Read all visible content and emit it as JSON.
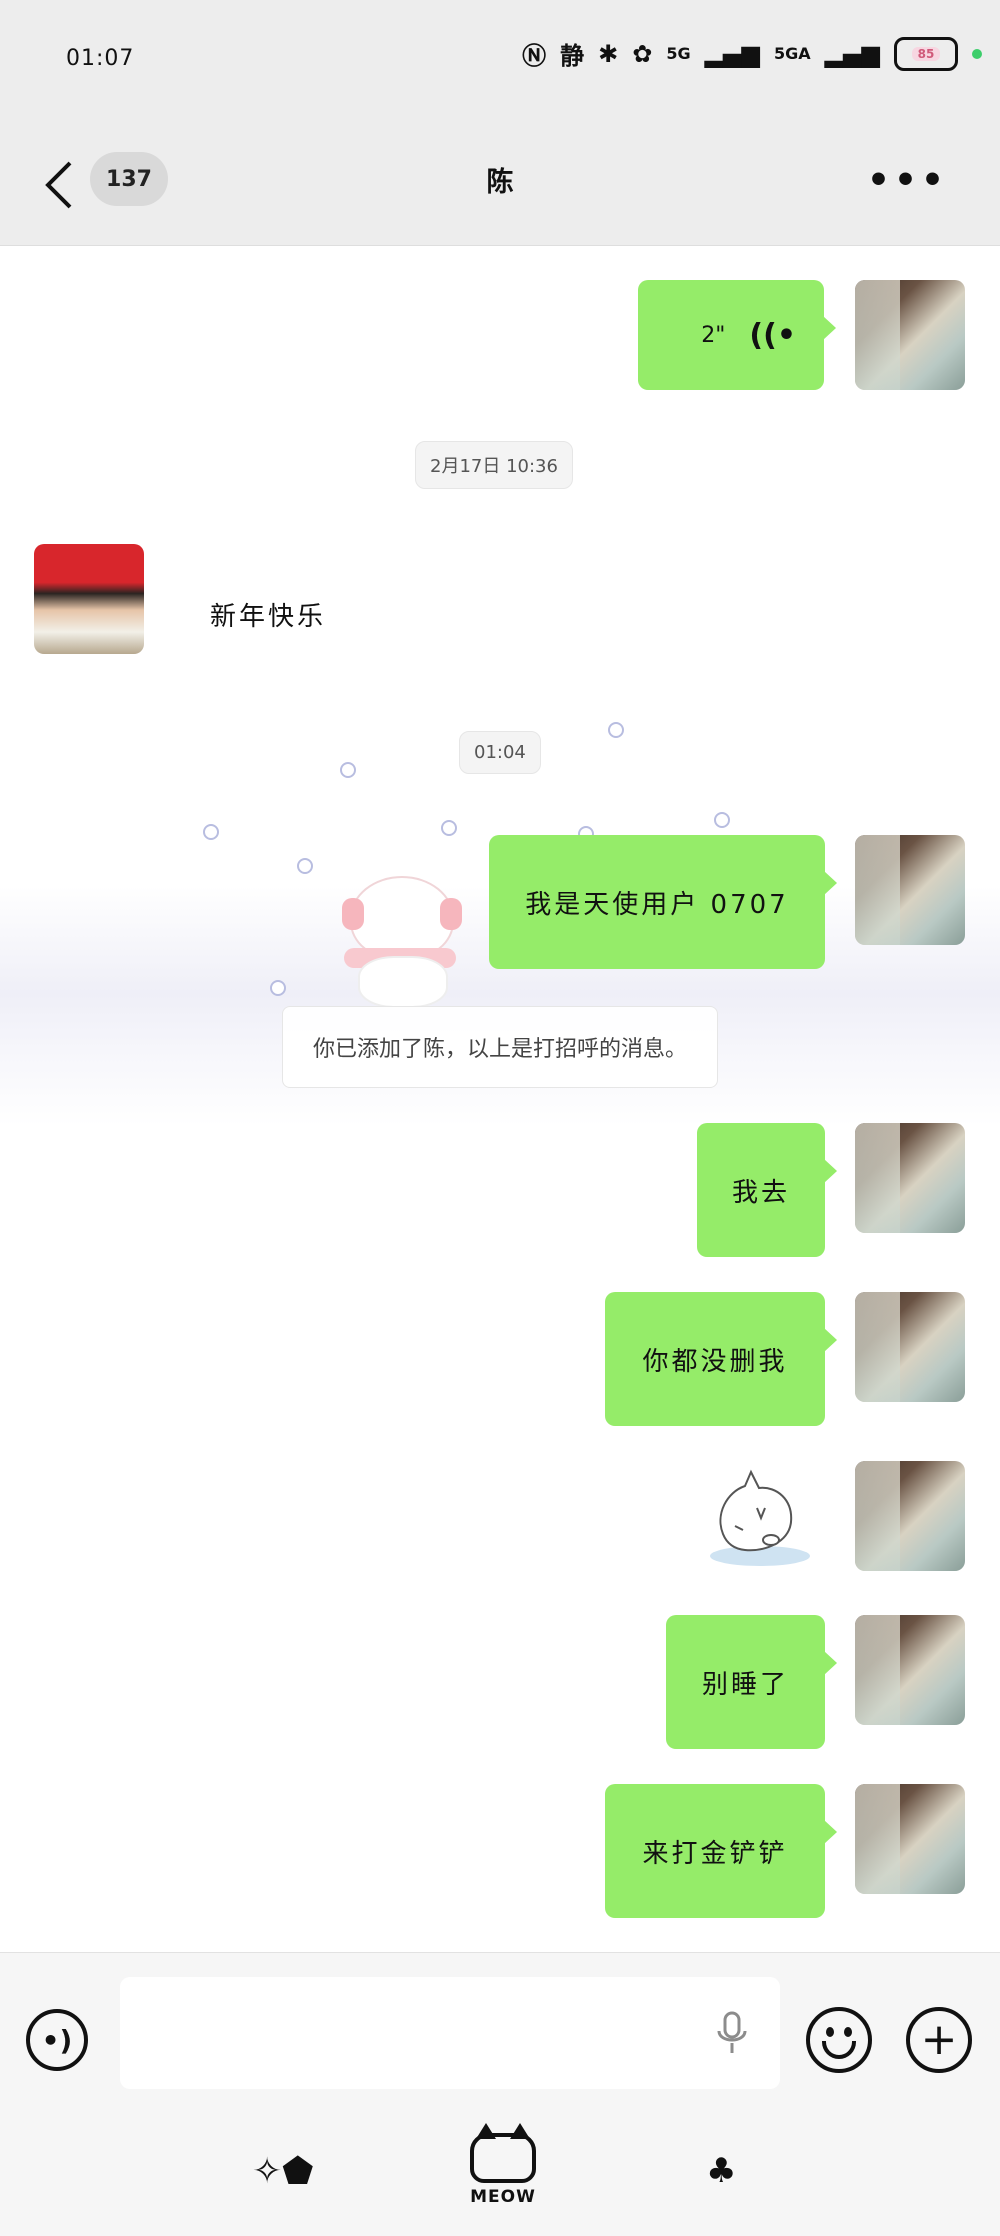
{
  "status": {
    "time": "01:07",
    "icons": [
      "nfc-icon",
      "silent-icon",
      "bluetooth-icon",
      "paw-icon"
    ],
    "silent_label": "静",
    "network1": "5G",
    "network2": "5GA",
    "battery": "85"
  },
  "nav": {
    "unread_count": "137",
    "title": "陈"
  },
  "messages": [
    {
      "from": "me",
      "type": "voice",
      "duration": "2\""
    },
    {
      "type": "time",
      "text": "2月17日 10:36"
    },
    {
      "from": "other",
      "type": "text",
      "text": "新年快乐"
    },
    {
      "type": "time",
      "text": "01:04"
    },
    {
      "from": "me",
      "type": "text",
      "text": "我是天使用户 0707"
    },
    {
      "type": "system",
      "text": "你已添加了陈，以上是打招呼的消息。"
    },
    {
      "from": "me",
      "type": "text",
      "text": "我去"
    },
    {
      "from": "me",
      "type": "text",
      "text": "你都没删我"
    },
    {
      "from": "me",
      "type": "sticker",
      "sticker": "cat-lying-sticker"
    },
    {
      "from": "me",
      "type": "text",
      "text": "别睡了"
    },
    {
      "from": "me",
      "type": "text",
      "text": "来打金铲铲"
    }
  ],
  "input": {
    "value": "",
    "placeholder": ""
  },
  "bottom_tabs": {
    "center_label": "MEOW"
  },
  "colors": {
    "bubble_me": "#95ec69",
    "header_bg": "#ededed"
  }
}
